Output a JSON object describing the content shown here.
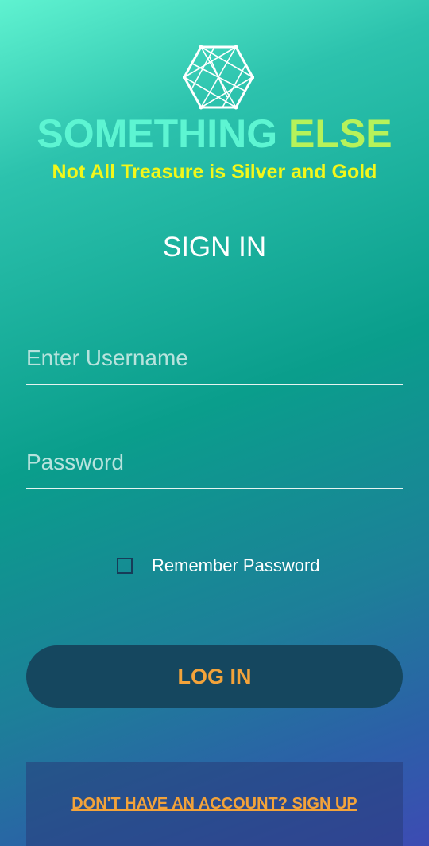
{
  "brand": {
    "word1": "SOMETHING",
    "word2": "ELSE",
    "tagline": "Not All Treasure is Silver and Gold",
    "logo_icon": "hexagon-network-icon"
  },
  "heading": "SIGN IN",
  "form": {
    "username_placeholder": "Enter Username",
    "username_value": "",
    "password_placeholder": "Password",
    "password_value": "",
    "remember_label": "Remember Password",
    "remember_checked": false,
    "login_label": "LOG IN"
  },
  "signup": {
    "link_label": "DON'T HAVE AN ACCOUNT? SIGN UP"
  },
  "colors": {
    "brand_primary": "#5df5d2",
    "brand_secondary": "#b6f25a",
    "tagline": "#f3f71a",
    "accent": "#f3a33a",
    "button_bg": "#15475f"
  }
}
